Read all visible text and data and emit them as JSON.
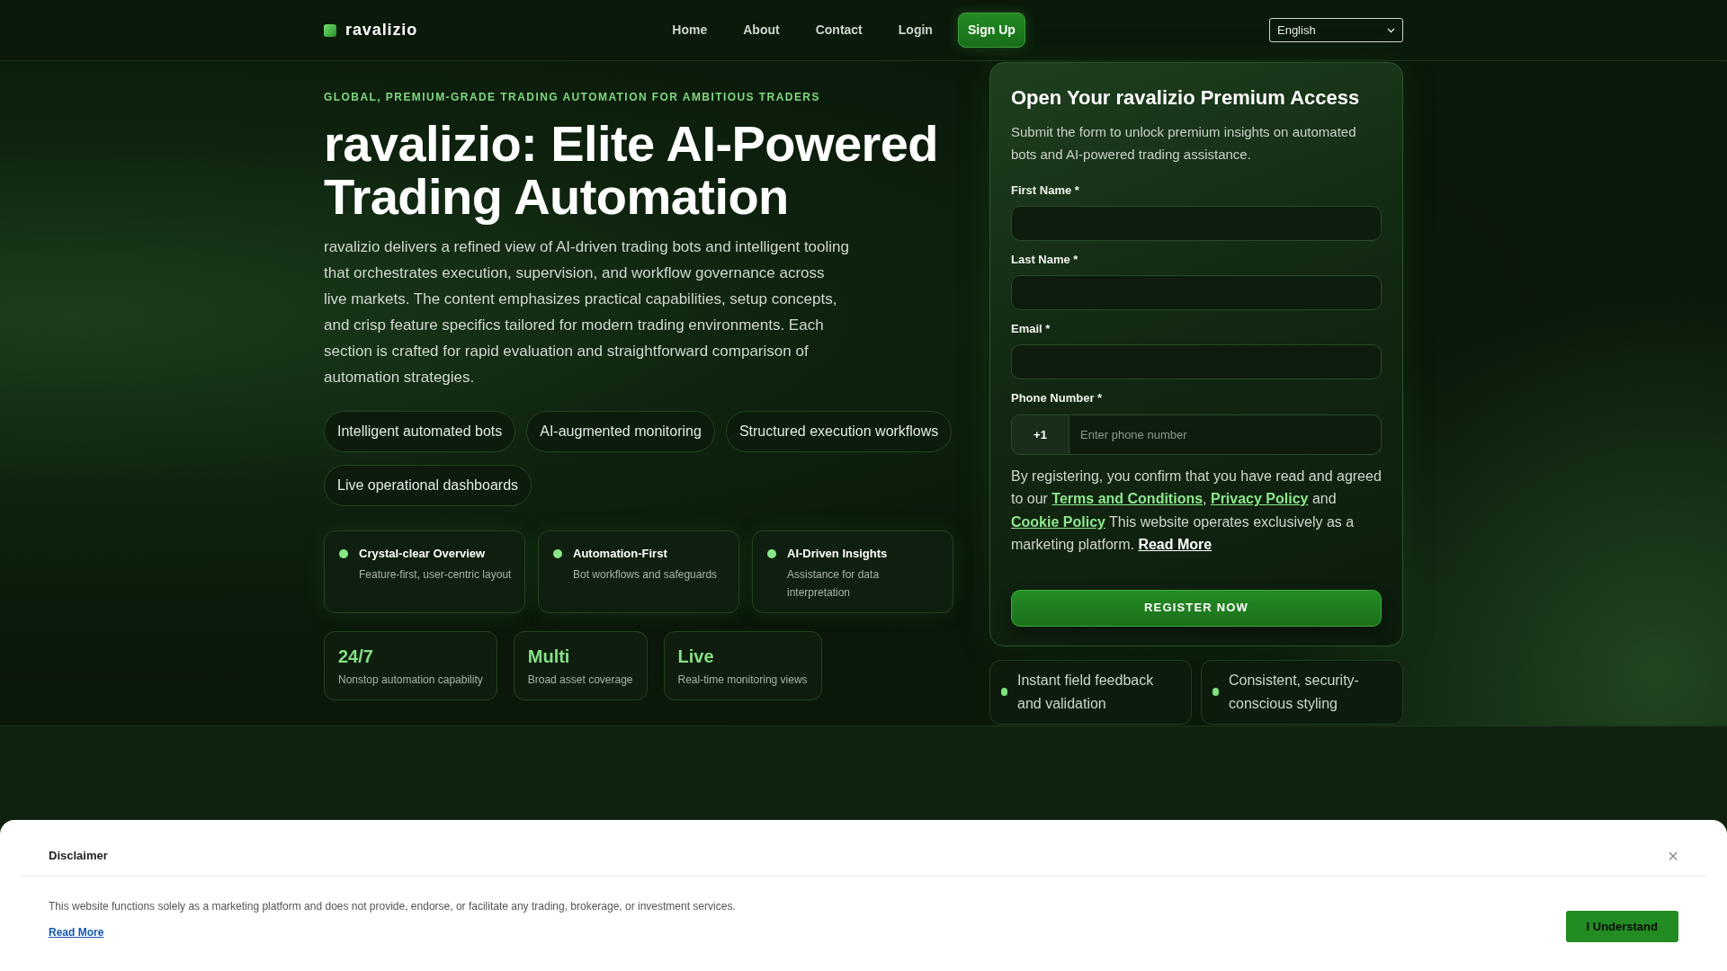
{
  "nav": {
    "brand": "ravalizio",
    "links": [
      "Home",
      "About",
      "Contact",
      "Login"
    ],
    "cta": "Sign Up",
    "language": "English"
  },
  "hero": {
    "eyebrow": "GLOBAL, PREMIUM-GRADE TRADING AUTOMATION FOR AMBITIOUS TRADERS",
    "title": "ravalizio: Elite AI-Powered Trading Automation",
    "description": "ravalizio delivers a refined view of AI-driven trading bots and intelligent tooling that orchestrates execution, supervision, and workflow governance across live markets. The content emphasizes practical capabilities, setup concepts, and crisp feature specifics tailored for modern trading environments. Each section is crafted for rapid evaluation and straightforward comparison of automation strategies.",
    "tags": [
      "Intelligent automated bots",
      "AI-augmented monitoring",
      "Structured execution workflows",
      "Live operational dashboards"
    ],
    "features": [
      {
        "title": "Crystal-clear Overview",
        "description": "Feature-first, user-centric layout"
      },
      {
        "title": "Automation-First",
        "description": "Bot workflows and safeguards"
      },
      {
        "title": "AI-Driven Insights",
        "description": "Assistance for data interpretation"
      }
    ],
    "stats": [
      {
        "value": "24/7",
        "label": "Nonstop automation capability"
      },
      {
        "value": "Multi",
        "label": "Broad asset coverage"
      },
      {
        "value": "Live",
        "label": "Real-time monitoring views"
      }
    ]
  },
  "form": {
    "title": "Open Your ravalizio Premium Access",
    "description": "Submit the form to unlock premium insights on automated bots and AI-powered trading assistance.",
    "fields": [
      {
        "kind": "text",
        "label": "First Name *"
      },
      {
        "kind": "text",
        "label": "Last Name *"
      },
      {
        "kind": "email",
        "label": "Email *"
      },
      {
        "kind": "phone",
        "label": "Phone Number *",
        "prefix": "+1",
        "placeholder": "Enter phone number"
      }
    ],
    "consent": [
      {
        "kind": "text",
        "text": "By registering, you confirm that you have read and agreed to our "
      },
      {
        "kind": "link",
        "text": "Terms and Conditions"
      },
      {
        "kind": "text",
        "text": ", "
      },
      {
        "kind": "link",
        "text": "Privacy Policy"
      },
      {
        "kind": "text",
        "text": " and "
      },
      {
        "kind": "link",
        "text": "Cookie Policy"
      },
      {
        "kind": "text",
        "text": " This website operates exclusively as a marketing platform. "
      },
      {
        "kind": "more",
        "text": "Read More"
      }
    ],
    "submit": "REGISTER NOW"
  },
  "highlights": [
    "Instant field feedback and validation",
    "Consistent, security-conscious styling"
  ],
  "disclaimer": {
    "title": "Disclaimer",
    "close": "×",
    "text": "This website functions solely as a marketing platform and does not provide, endorse, or facilitate any trading, brokerage, or investment services.",
    "link": "Read More",
    "button": "I Understand"
  }
}
